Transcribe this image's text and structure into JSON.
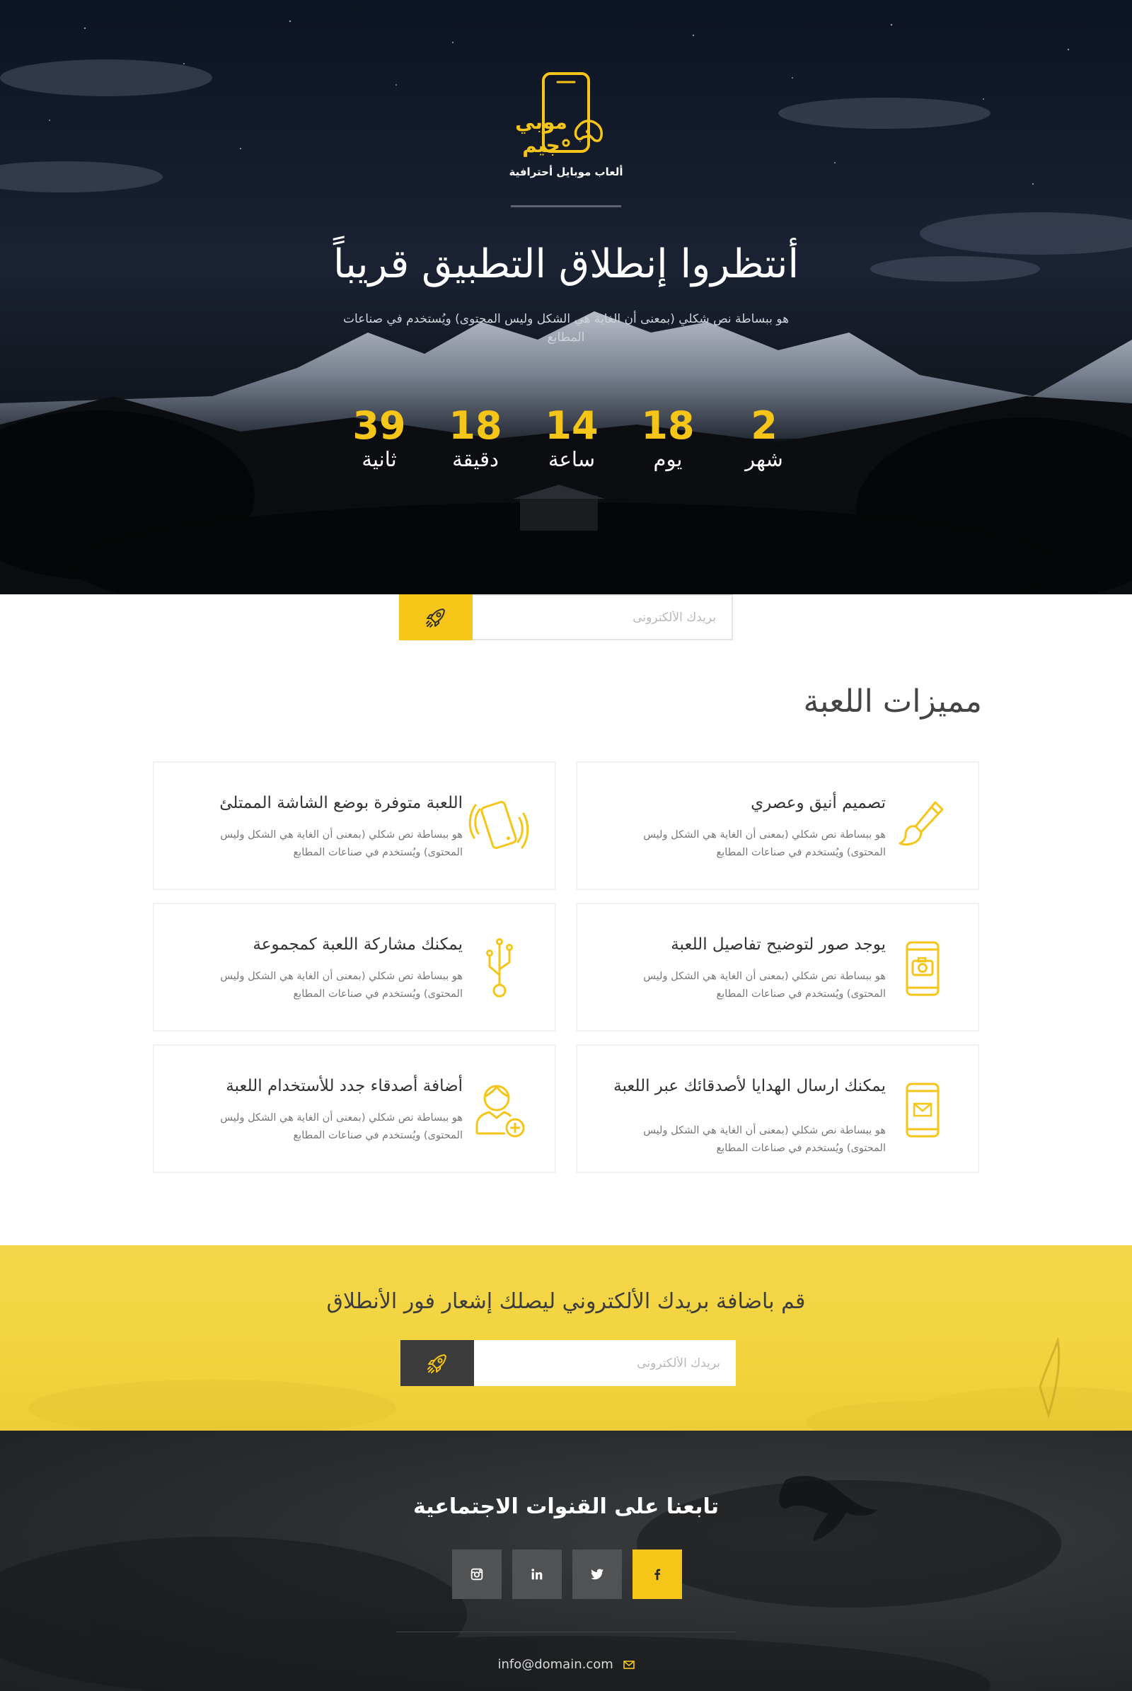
{
  "colors": {
    "accent": "#f5c518",
    "dark": "#3b3b3b",
    "hero_bg": "#10131a",
    "notify_bg": "#f3d440",
    "footer_bg": "#2b2e30",
    "social_bg": "#505254"
  },
  "brand": {
    "name": "موبي جيم",
    "tagline": "ألعاب موبايل أحترافية",
    "logo_icon": "phone-gamepad-icon"
  },
  "hero": {
    "title": "أنتظروا إنطلاق التطبيق قريباً",
    "subtitle": "هو ببساطة نص شكلي (بمعنى أن الغاية هي الشكل وليس المحتوى) ويُستخدم في صناعات المطابع"
  },
  "countdown": [
    {
      "value": "2",
      "label": "شهر"
    },
    {
      "value": "18",
      "label": "يوم"
    },
    {
      "value": "14",
      "label": "ساعة"
    },
    {
      "value": "18",
      "label": "دقيقة"
    },
    {
      "value": "39",
      "label": "ثانية"
    }
  ],
  "subscribe": {
    "placeholder": "بريدك الألكترونى",
    "button_icon": "rocket-icon"
  },
  "features": {
    "title": "مميزات اللعبة",
    "items": [
      {
        "title": "تصميم أنيق وعصري",
        "text": "هو ببساطة نص شكلي (بمعنى أن الغاية هي الشكل وليس المحتوى) ويُستخدم في صناعات المطابع",
        "icon": "paintbrush-icon"
      },
      {
        "title": "اللعبة متوفرة بوضع الشاشة الممتلئ",
        "text": "هو ببساطة نص شكلي (بمعنى أن الغاية هي الشكل وليس المحتوى) ويُستخدم في صناعات المطابع",
        "icon": "vibrating-phone-icon"
      },
      {
        "title": "يوجد صور لتوضيح تفاصيل اللعبة",
        "text": "هو ببساطة نص شكلي (بمعنى أن الغاية هي الشكل وليس المحتوى) ويُستخدم في صناعات المطابع",
        "icon": "phone-camera-icon"
      },
      {
        "title": "يمكنك مشاركة اللعبة كمجموعة",
        "text": "هو ببساطة نص شكلي (بمعنى أن الغاية هي الشكل وليس المحتوى) ويُستخدم في صناعات المطابع",
        "icon": "usb-share-icon"
      },
      {
        "title": "يمكنك ارسال الهدايا لأصدقائك عبر اللعبة",
        "text": "هو ببساطة نص شكلي (بمعنى أن الغاية هي الشكل وليس المحتوى) ويُستخدم في صناعات المطابع",
        "icon": "phone-mail-icon"
      },
      {
        "title": "أضافة أصدقاء جدد للأستخدام اللعبة",
        "text": "هو ببساطة نص شكلي (بمعنى أن الغاية هي الشكل وليس المحتوى) ويُستخدم في صناعات المطابع",
        "icon": "add-user-icon"
      }
    ]
  },
  "notify": {
    "title": "قم باضافة بريدك الألكتروني ليصلك إشعار فور الأنطلاق",
    "placeholder": "بريدك الألكترونى",
    "button_icon": "rocket-icon"
  },
  "footer": {
    "title": "تابعنا على القنوات الاجتماعية",
    "socials": [
      {
        "name": "facebook",
        "icon": "facebook-icon"
      },
      {
        "name": "twitter",
        "icon": "twitter-icon"
      },
      {
        "name": "linkedin",
        "icon": "linkedin-icon"
      },
      {
        "name": "instagram",
        "icon": "instagram-icon"
      }
    ],
    "email": "info@domain.com",
    "email_icon": "envelope-icon"
  }
}
